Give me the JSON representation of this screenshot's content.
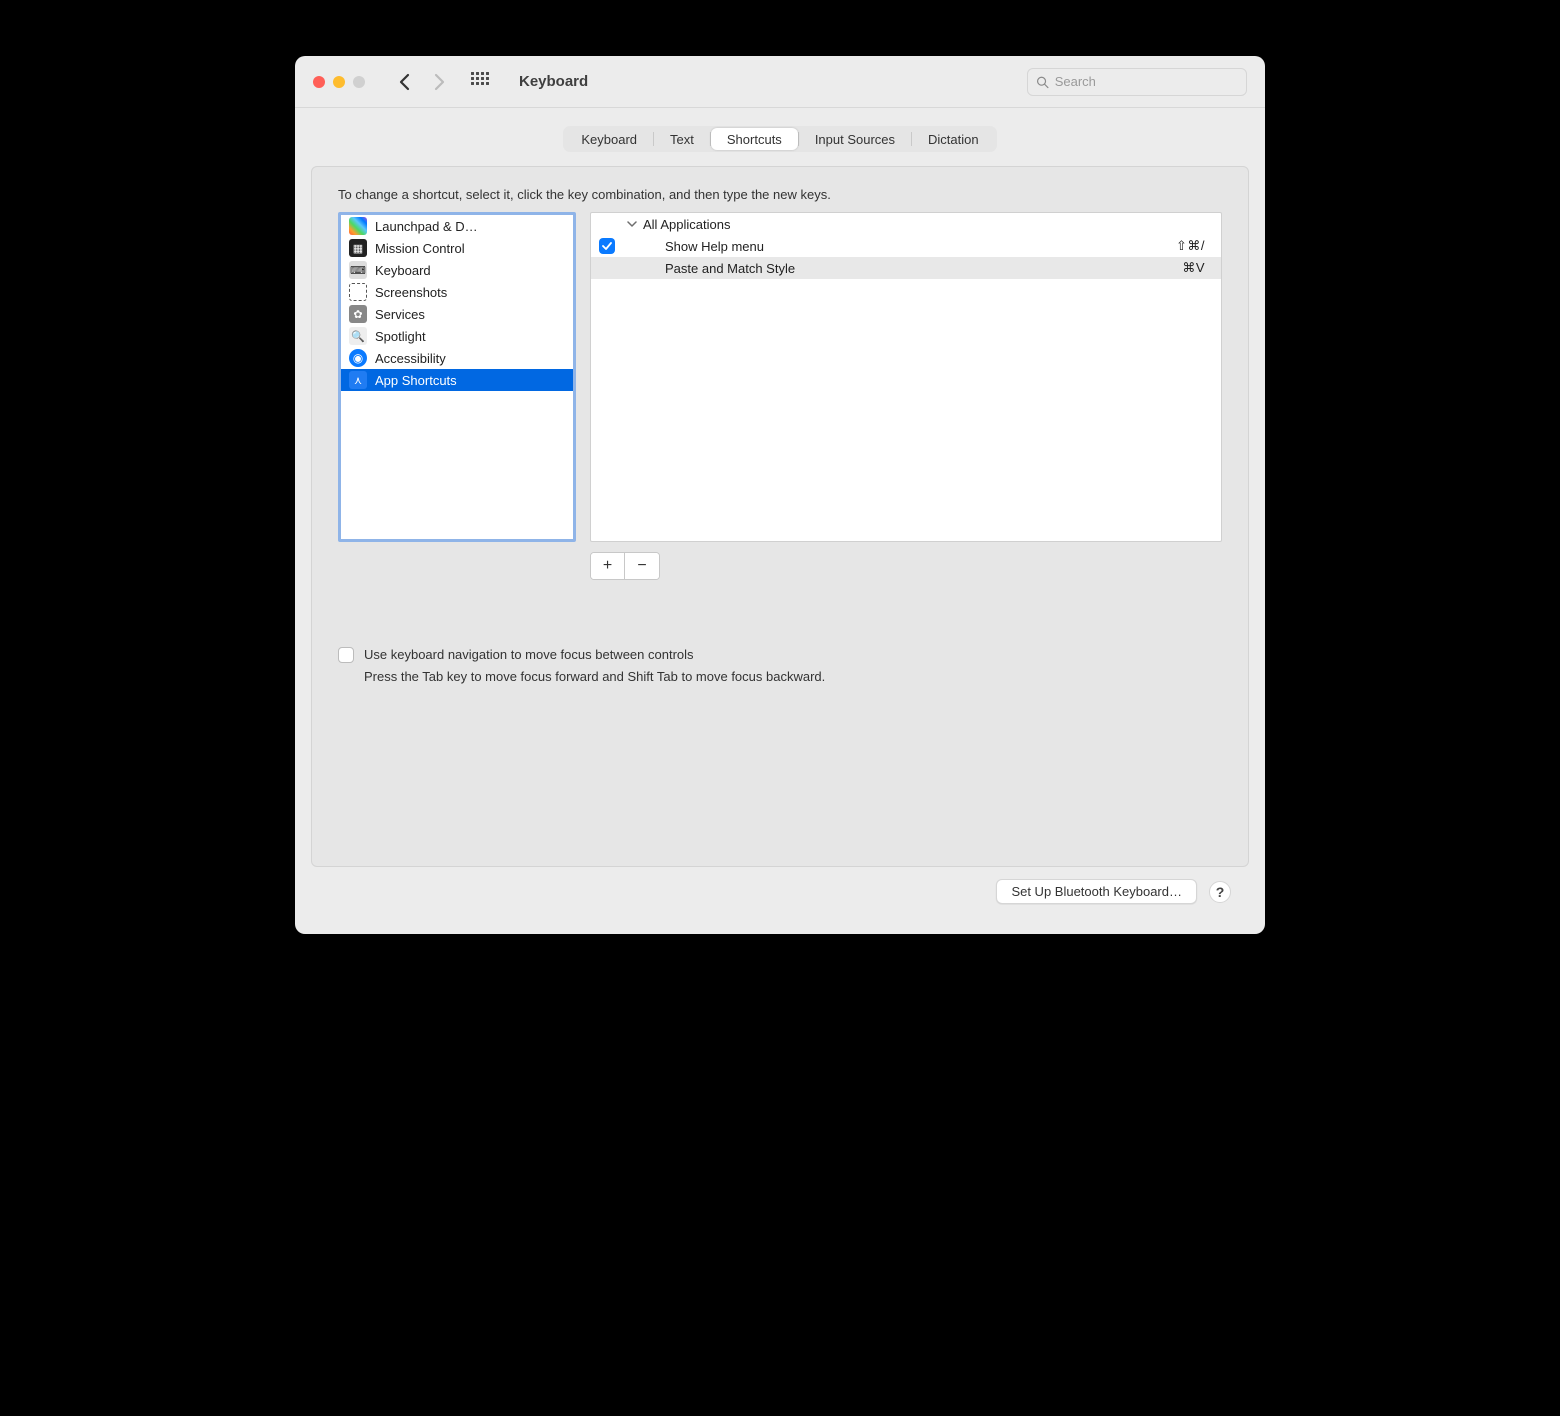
{
  "window": {
    "title": "Keyboard"
  },
  "search": {
    "placeholder": "Search"
  },
  "tabs": [
    {
      "label": "Keyboard"
    },
    {
      "label": "Text"
    },
    {
      "label": "Shortcuts",
      "active": true
    },
    {
      "label": "Input Sources"
    },
    {
      "label": "Dictation"
    }
  ],
  "instruction": "To change a shortcut, select it, click the key combination, and then type the new keys.",
  "categories": [
    {
      "label": "Launchpad & D…",
      "icon": "launchpad"
    },
    {
      "label": "Mission Control",
      "icon": "mission-control"
    },
    {
      "label": "Keyboard",
      "icon": "keyboard"
    },
    {
      "label": "Screenshots",
      "icon": "screenshots"
    },
    {
      "label": "Services",
      "icon": "services"
    },
    {
      "label": "Spotlight",
      "icon": "spotlight"
    },
    {
      "label": "Accessibility",
      "icon": "accessibility"
    },
    {
      "label": "App Shortcuts",
      "icon": "app-shortcuts",
      "selected": true
    }
  ],
  "shortcuts": {
    "group_label": "All Applications",
    "items": [
      {
        "checked": true,
        "label": "Show Help menu",
        "shortcut": "⇧⌘/"
      },
      {
        "checked": null,
        "label": "Paste and Match Style",
        "shortcut": "⌘V",
        "alt": true
      }
    ]
  },
  "buttons": {
    "add": "+",
    "remove": "−"
  },
  "kb_nav": {
    "label": "Use keyboard navigation to move focus between controls",
    "sub": "Press the Tab key to move focus forward and Shift Tab to move focus backward."
  },
  "footer": {
    "bluetooth": "Set Up Bluetooth Keyboard…",
    "help": "?"
  }
}
